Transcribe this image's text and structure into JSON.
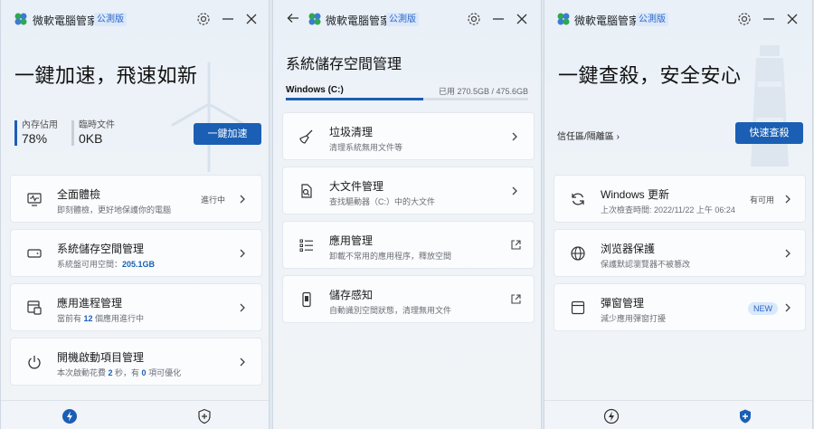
{
  "app": {
    "title": "微軟電腦管家",
    "edition_badge": "公測版"
  },
  "colors": {
    "accent": "#1a5fb4",
    "logo_green": "#2fa84f",
    "logo_blue": "#3a7bd5"
  },
  "panel1": {
    "hero": "一鍵加速，飛速如新",
    "stats": [
      {
        "label": "內存佔用",
        "value": "78%"
      },
      {
        "label": "臨時文件",
        "value": "0KB"
      }
    ],
    "primary_button": "一鍵加速",
    "cards": [
      {
        "icon": "monitor-health-icon",
        "title": "全面體檢",
        "sub_parts": [
          "即刻體檢，更好地保護你的電腦"
        ],
        "status": "進行中"
      },
      {
        "icon": "storage-drive-icon",
        "title": "系統儲存空間管理",
        "sub_parts": [
          "系統盤可用空間：",
          "205.1GB",
          ""
        ],
        "status": ""
      },
      {
        "icon": "app-process-icon",
        "title": "應用進程管理",
        "sub_parts": [
          "當前有 ",
          "12",
          " 個應用進行中"
        ],
        "status": ""
      },
      {
        "icon": "power-icon",
        "title": "開機啟動項目管理",
        "sub_parts": [
          "本次啟動花費 ",
          "2",
          " 秒，有 ",
          "0",
          " 項可優化"
        ],
        "status": ""
      }
    ],
    "nav": [
      "lightning-icon",
      "shield-plus-icon"
    ]
  },
  "panel2": {
    "title": "系統儲存空間管理",
    "drive": {
      "label": "Windows (C:)",
      "used_text": "已用 270.5GB / 475.6GB",
      "used_fraction": 0.569
    },
    "cards": [
      {
        "icon": "broom-icon",
        "title": "垃圾清理",
        "sub": "清理系統無用文件等",
        "action": "chevron"
      },
      {
        "icon": "document-search-icon",
        "title": "大文件管理",
        "sub": "查找驅動器（C:）中的大文件",
        "action": "chevron"
      },
      {
        "icon": "list-icon",
        "title": "應用管理",
        "sub": "卸載不常用的應用程序，釋放空間",
        "action": "external"
      },
      {
        "icon": "phone-storage-icon",
        "title": "儲存感知",
        "sub": "自動識別空間狀態，清理無用文件",
        "action": "external"
      }
    ]
  },
  "panel3": {
    "hero": "一鍵查殺，安全安心",
    "link": "信任區/隔離區",
    "primary_button": "快速查殺",
    "cards": [
      {
        "icon": "refresh-icon",
        "title": "Windows 更新",
        "sub": "上次檢查時間: 2022/11/22 上午 06:24",
        "status": "有可用",
        "badge": ""
      },
      {
        "icon": "globe-icon",
        "title": "浏览器保護",
        "sub": "保護默認瀏覽器不被篡改",
        "status": "",
        "badge": ""
      },
      {
        "icon": "popup-window-icon",
        "title": "彈窗管理",
        "sub": "減少應用彈窗打擾",
        "status": "",
        "badge": "NEW"
      }
    ],
    "nav": [
      "lightning-icon",
      "shield-plus-icon"
    ]
  }
}
